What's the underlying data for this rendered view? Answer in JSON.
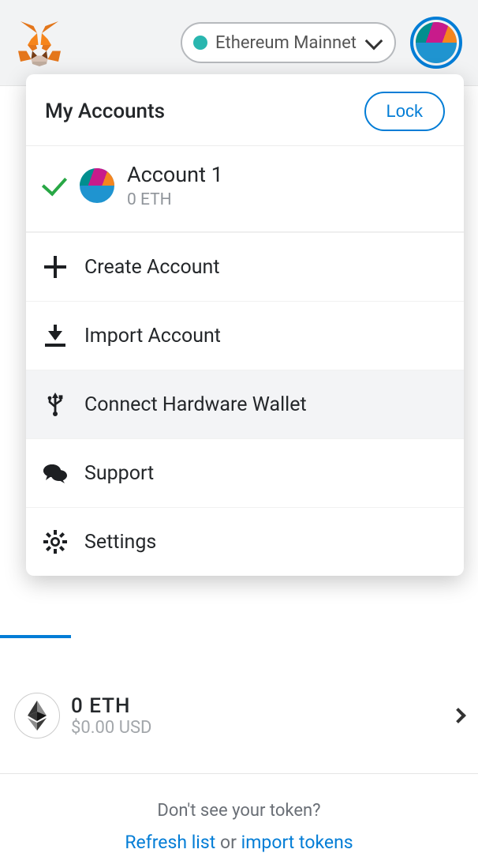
{
  "header": {
    "network_label": "Ethereum Mainnet"
  },
  "panel": {
    "title": "My Accounts",
    "lock_label": "Lock",
    "account": {
      "name": "Account 1",
      "balance": "0 ETH"
    },
    "menu": {
      "create": "Create Account",
      "import": "Import Account",
      "hardware": "Connect Hardware Wallet",
      "support": "Support",
      "settings": "Settings"
    }
  },
  "asset_row": {
    "amount": "0 ETH",
    "usd": "$0.00 USD"
  },
  "footer": {
    "question": "Don't see your token?",
    "refresh": "Refresh list",
    "or": "or",
    "import": "import tokens"
  }
}
